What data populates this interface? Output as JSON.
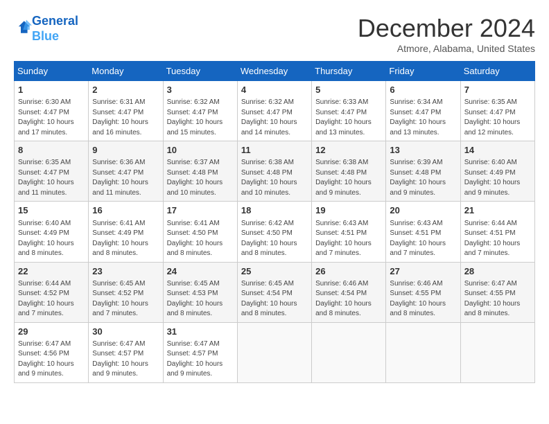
{
  "header": {
    "logo_line1": "General",
    "logo_line2": "Blue",
    "month": "December 2024",
    "location": "Atmore, Alabama, United States"
  },
  "weekdays": [
    "Sunday",
    "Monday",
    "Tuesday",
    "Wednesday",
    "Thursday",
    "Friday",
    "Saturday"
  ],
  "weeks": [
    [
      {
        "day": "1",
        "sunrise": "6:30 AM",
        "sunset": "4:47 PM",
        "daylight": "10 hours and 17 minutes."
      },
      {
        "day": "2",
        "sunrise": "6:31 AM",
        "sunset": "4:47 PM",
        "daylight": "10 hours and 16 minutes."
      },
      {
        "day": "3",
        "sunrise": "6:32 AM",
        "sunset": "4:47 PM",
        "daylight": "10 hours and 15 minutes."
      },
      {
        "day": "4",
        "sunrise": "6:32 AM",
        "sunset": "4:47 PM",
        "daylight": "10 hours and 14 minutes."
      },
      {
        "day": "5",
        "sunrise": "6:33 AM",
        "sunset": "4:47 PM",
        "daylight": "10 hours and 13 minutes."
      },
      {
        "day": "6",
        "sunrise": "6:34 AM",
        "sunset": "4:47 PM",
        "daylight": "10 hours and 13 minutes."
      },
      {
        "day": "7",
        "sunrise": "6:35 AM",
        "sunset": "4:47 PM",
        "daylight": "10 hours and 12 minutes."
      }
    ],
    [
      {
        "day": "8",
        "sunrise": "6:35 AM",
        "sunset": "4:47 PM",
        "daylight": "10 hours and 11 minutes."
      },
      {
        "day": "9",
        "sunrise": "6:36 AM",
        "sunset": "4:47 PM",
        "daylight": "10 hours and 11 minutes."
      },
      {
        "day": "10",
        "sunrise": "6:37 AM",
        "sunset": "4:48 PM",
        "daylight": "10 hours and 10 minutes."
      },
      {
        "day": "11",
        "sunrise": "6:38 AM",
        "sunset": "4:48 PM",
        "daylight": "10 hours and 10 minutes."
      },
      {
        "day": "12",
        "sunrise": "6:38 AM",
        "sunset": "4:48 PM",
        "daylight": "10 hours and 9 minutes."
      },
      {
        "day": "13",
        "sunrise": "6:39 AM",
        "sunset": "4:48 PM",
        "daylight": "10 hours and 9 minutes."
      },
      {
        "day": "14",
        "sunrise": "6:40 AM",
        "sunset": "4:49 PM",
        "daylight": "10 hours and 9 minutes."
      }
    ],
    [
      {
        "day": "15",
        "sunrise": "6:40 AM",
        "sunset": "4:49 PM",
        "daylight": "10 hours and 8 minutes."
      },
      {
        "day": "16",
        "sunrise": "6:41 AM",
        "sunset": "4:49 PM",
        "daylight": "10 hours and 8 minutes."
      },
      {
        "day": "17",
        "sunrise": "6:41 AM",
        "sunset": "4:50 PM",
        "daylight": "10 hours and 8 minutes."
      },
      {
        "day": "18",
        "sunrise": "6:42 AM",
        "sunset": "4:50 PM",
        "daylight": "10 hours and 8 minutes."
      },
      {
        "day": "19",
        "sunrise": "6:43 AM",
        "sunset": "4:51 PM",
        "daylight": "10 hours and 7 minutes."
      },
      {
        "day": "20",
        "sunrise": "6:43 AM",
        "sunset": "4:51 PM",
        "daylight": "10 hours and 7 minutes."
      },
      {
        "day": "21",
        "sunrise": "6:44 AM",
        "sunset": "4:51 PM",
        "daylight": "10 hours and 7 minutes."
      }
    ],
    [
      {
        "day": "22",
        "sunrise": "6:44 AM",
        "sunset": "4:52 PM",
        "daylight": "10 hours and 7 minutes."
      },
      {
        "day": "23",
        "sunrise": "6:45 AM",
        "sunset": "4:52 PM",
        "daylight": "10 hours and 7 minutes."
      },
      {
        "day": "24",
        "sunrise": "6:45 AM",
        "sunset": "4:53 PM",
        "daylight": "10 hours and 8 minutes."
      },
      {
        "day": "25",
        "sunrise": "6:45 AM",
        "sunset": "4:54 PM",
        "daylight": "10 hours and 8 minutes."
      },
      {
        "day": "26",
        "sunrise": "6:46 AM",
        "sunset": "4:54 PM",
        "daylight": "10 hours and 8 minutes."
      },
      {
        "day": "27",
        "sunrise": "6:46 AM",
        "sunset": "4:55 PM",
        "daylight": "10 hours and 8 minutes."
      },
      {
        "day": "28",
        "sunrise": "6:47 AM",
        "sunset": "4:55 PM",
        "daylight": "10 hours and 8 minutes."
      }
    ],
    [
      {
        "day": "29",
        "sunrise": "6:47 AM",
        "sunset": "4:56 PM",
        "daylight": "10 hours and 9 minutes."
      },
      {
        "day": "30",
        "sunrise": "6:47 AM",
        "sunset": "4:57 PM",
        "daylight": "10 hours and 9 minutes."
      },
      {
        "day": "31",
        "sunrise": "6:47 AM",
        "sunset": "4:57 PM",
        "daylight": "10 hours and 9 minutes."
      },
      null,
      null,
      null,
      null
    ]
  ]
}
